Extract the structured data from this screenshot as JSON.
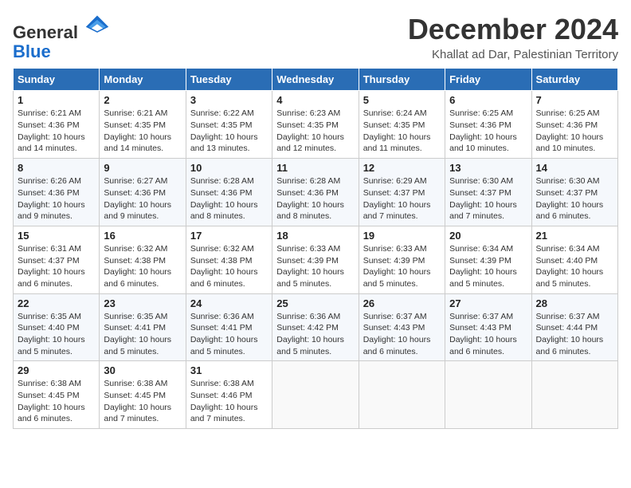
{
  "header": {
    "logo_line1": "General",
    "logo_line2": "Blue",
    "month_title": "December 2024",
    "location": "Khallat ad Dar, Palestinian Territory"
  },
  "weekdays": [
    "Sunday",
    "Monday",
    "Tuesday",
    "Wednesday",
    "Thursday",
    "Friday",
    "Saturday"
  ],
  "weeks": [
    [
      {
        "day": "1",
        "sunrise": "6:21 AM",
        "sunset": "4:36 PM",
        "daylight": "10 hours and 14 minutes."
      },
      {
        "day": "2",
        "sunrise": "6:21 AM",
        "sunset": "4:35 PM",
        "daylight": "10 hours and 14 minutes."
      },
      {
        "day": "3",
        "sunrise": "6:22 AM",
        "sunset": "4:35 PM",
        "daylight": "10 hours and 13 minutes."
      },
      {
        "day": "4",
        "sunrise": "6:23 AM",
        "sunset": "4:35 PM",
        "daylight": "10 hours and 12 minutes."
      },
      {
        "day": "5",
        "sunrise": "6:24 AM",
        "sunset": "4:35 PM",
        "daylight": "10 hours and 11 minutes."
      },
      {
        "day": "6",
        "sunrise": "6:25 AM",
        "sunset": "4:36 PM",
        "daylight": "10 hours and 10 minutes."
      },
      {
        "day": "7",
        "sunrise": "6:25 AM",
        "sunset": "4:36 PM",
        "daylight": "10 hours and 10 minutes."
      }
    ],
    [
      {
        "day": "8",
        "sunrise": "6:26 AM",
        "sunset": "4:36 PM",
        "daylight": "10 hours and 9 minutes."
      },
      {
        "day": "9",
        "sunrise": "6:27 AM",
        "sunset": "4:36 PM",
        "daylight": "10 hours and 9 minutes."
      },
      {
        "day": "10",
        "sunrise": "6:28 AM",
        "sunset": "4:36 PM",
        "daylight": "10 hours and 8 minutes."
      },
      {
        "day": "11",
        "sunrise": "6:28 AM",
        "sunset": "4:36 PM",
        "daylight": "10 hours and 8 minutes."
      },
      {
        "day": "12",
        "sunrise": "6:29 AM",
        "sunset": "4:37 PM",
        "daylight": "10 hours and 7 minutes."
      },
      {
        "day": "13",
        "sunrise": "6:30 AM",
        "sunset": "4:37 PM",
        "daylight": "10 hours and 7 minutes."
      },
      {
        "day": "14",
        "sunrise": "6:30 AM",
        "sunset": "4:37 PM",
        "daylight": "10 hours and 6 minutes."
      }
    ],
    [
      {
        "day": "15",
        "sunrise": "6:31 AM",
        "sunset": "4:37 PM",
        "daylight": "10 hours and 6 minutes."
      },
      {
        "day": "16",
        "sunrise": "6:32 AM",
        "sunset": "4:38 PM",
        "daylight": "10 hours and 6 minutes."
      },
      {
        "day": "17",
        "sunrise": "6:32 AM",
        "sunset": "4:38 PM",
        "daylight": "10 hours and 6 minutes."
      },
      {
        "day": "18",
        "sunrise": "6:33 AM",
        "sunset": "4:39 PM",
        "daylight": "10 hours and 5 minutes."
      },
      {
        "day": "19",
        "sunrise": "6:33 AM",
        "sunset": "4:39 PM",
        "daylight": "10 hours and 5 minutes."
      },
      {
        "day": "20",
        "sunrise": "6:34 AM",
        "sunset": "4:39 PM",
        "daylight": "10 hours and 5 minutes."
      },
      {
        "day": "21",
        "sunrise": "6:34 AM",
        "sunset": "4:40 PM",
        "daylight": "10 hours and 5 minutes."
      }
    ],
    [
      {
        "day": "22",
        "sunrise": "6:35 AM",
        "sunset": "4:40 PM",
        "daylight": "10 hours and 5 minutes."
      },
      {
        "day": "23",
        "sunrise": "6:35 AM",
        "sunset": "4:41 PM",
        "daylight": "10 hours and 5 minutes."
      },
      {
        "day": "24",
        "sunrise": "6:36 AM",
        "sunset": "4:41 PM",
        "daylight": "10 hours and 5 minutes."
      },
      {
        "day": "25",
        "sunrise": "6:36 AM",
        "sunset": "4:42 PM",
        "daylight": "10 hours and 5 minutes."
      },
      {
        "day": "26",
        "sunrise": "6:37 AM",
        "sunset": "4:43 PM",
        "daylight": "10 hours and 6 minutes."
      },
      {
        "day": "27",
        "sunrise": "6:37 AM",
        "sunset": "4:43 PM",
        "daylight": "10 hours and 6 minutes."
      },
      {
        "day": "28",
        "sunrise": "6:37 AM",
        "sunset": "4:44 PM",
        "daylight": "10 hours and 6 minutes."
      }
    ],
    [
      {
        "day": "29",
        "sunrise": "6:38 AM",
        "sunset": "4:45 PM",
        "daylight": "10 hours and 6 minutes."
      },
      {
        "day": "30",
        "sunrise": "6:38 AM",
        "sunset": "4:45 PM",
        "daylight": "10 hours and 7 minutes."
      },
      {
        "day": "31",
        "sunrise": "6:38 AM",
        "sunset": "4:46 PM",
        "daylight": "10 hours and 7 minutes."
      },
      null,
      null,
      null,
      null
    ]
  ]
}
